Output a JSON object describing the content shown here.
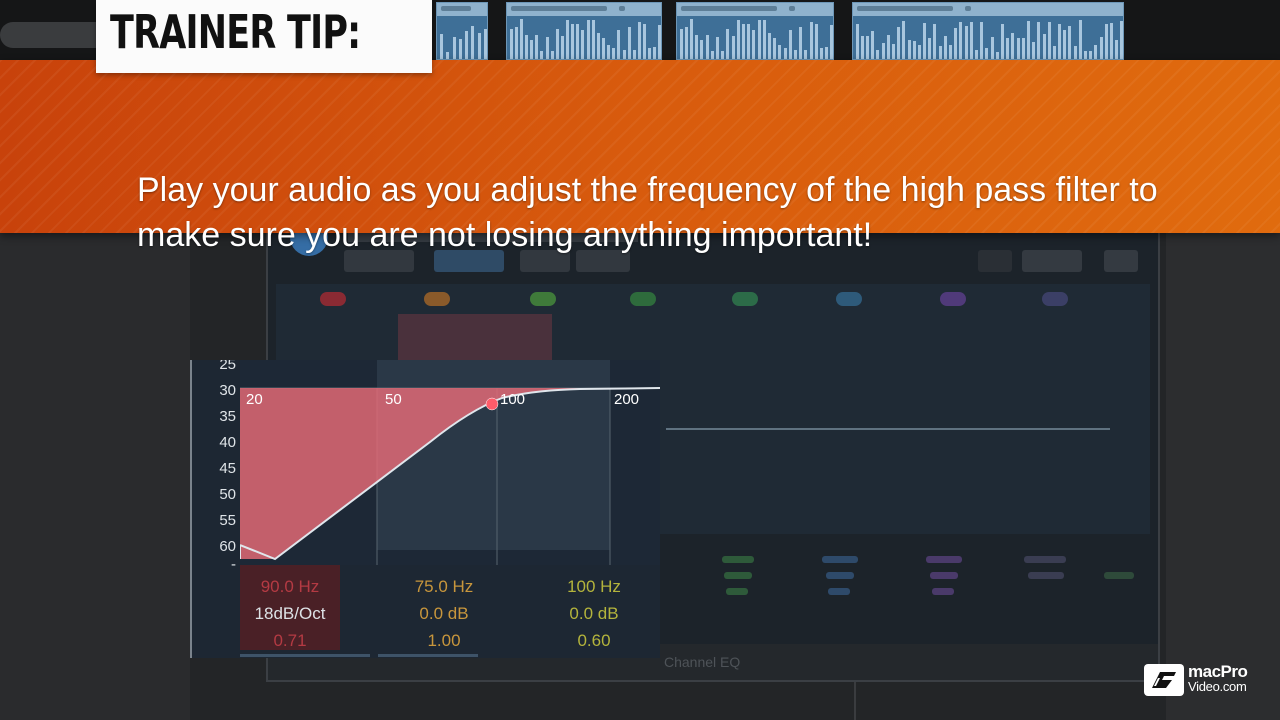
{
  "tip": {
    "label": "TRAINER TIP:",
    "text": "Play your audio as you adjust the frequency of the high pass filter to make sure you are not losing anything important!"
  },
  "eq_inset": {
    "db_scale": [
      "25",
      "30",
      "35",
      "40",
      "45",
      "50",
      "55",
      "60",
      "-"
    ],
    "freq_labels": [
      "20",
      "50",
      "100",
      "200"
    ],
    "bands": [
      {
        "frequency": "90.0 Hz",
        "gain": "18dB/Oct",
        "q": "0.71",
        "color": "#b43a43"
      },
      {
        "frequency": "75.0 Hz",
        "gain": "0.0 dB",
        "q": "1.00",
        "color": "#c8963c"
      },
      {
        "frequency": "100 Hz",
        "gain": "0.0 dB",
        "q": "0.60",
        "color": "#b4b43c"
      }
    ],
    "curve_color": "#e86b78",
    "footer": "Channel EQ"
  },
  "logo": {
    "line1": "macPro",
    "line2": "Video.com"
  },
  "colors": {
    "banner_start": "#c8420b",
    "banner_end": "#e06b0e",
    "eq_fill": "#e86b78"
  }
}
